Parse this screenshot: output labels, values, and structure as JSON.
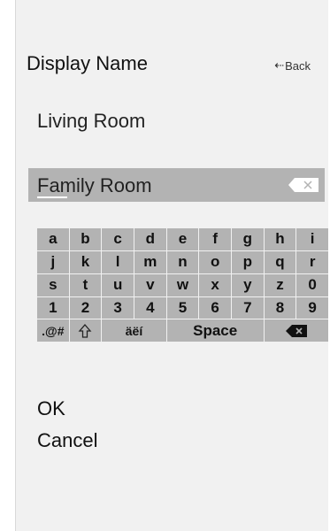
{
  "header": {
    "title": "Display Name",
    "back_label": "Back",
    "back_icon": "arrow-left-icon"
  },
  "options": [
    "Living Room"
  ],
  "field": {
    "value": "Family Room",
    "clear_icon": "clear-icon"
  },
  "keyboard": {
    "rows": [
      [
        "a",
        "b",
        "c",
        "d",
        "e",
        "f",
        "g",
        "h",
        "i"
      ],
      [
        "j",
        "k",
        "l",
        "m",
        "n",
        "o",
        "p",
        "q",
        "r"
      ],
      [
        "s",
        "t",
        "u",
        "v",
        "w",
        "x",
        "y",
        "z",
        "0"
      ],
      [
        "1",
        "2",
        "3",
        "4",
        "5",
        "6",
        "7",
        "8",
        "9"
      ]
    ],
    "bottom": {
      "symbols": ".@#",
      "shift_icon": "shift-icon",
      "accents": "äëí",
      "space": "Space",
      "backspace_icon": "backspace-icon"
    }
  },
  "actions": {
    "ok": "OK",
    "cancel": "Cancel"
  }
}
